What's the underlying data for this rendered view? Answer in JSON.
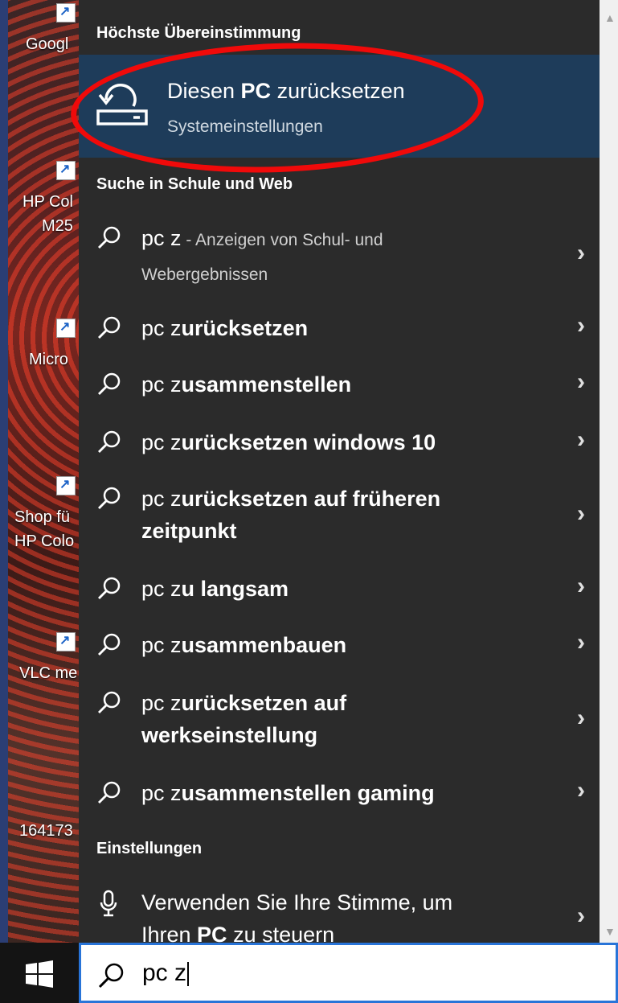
{
  "desktop": {
    "icons": [
      {
        "label": "Googl"
      },
      {
        "label": "HP Col"
      },
      {
        "label": "M25"
      },
      {
        "label": "Micro"
      },
      {
        "label": "Shop fü"
      },
      {
        "label": "HP Colo"
      },
      {
        "label": "VLC me"
      },
      {
        "label": "164173"
      }
    ]
  },
  "search_panel": {
    "best_match_heading": "Höchste Übereinstimmung",
    "best_match": {
      "title_pre": "Diesen ",
      "title_bold": "PC",
      "title_post": " zurücksetzen",
      "subtitle": "Systemeinstellungen",
      "icon": "reset-pc-icon"
    },
    "web_heading": "Suche in Schule und Web",
    "suggestions": [
      {
        "prefix": "pc z",
        "bold": "",
        "hint": " - Anzeigen von Schul- und",
        "line2": "Webergebnissen",
        "line2_bold": false
      },
      {
        "prefix": "pc z",
        "bold": "urücksetzen",
        "hint": "",
        "line2": "",
        "line2_bold": false
      },
      {
        "prefix": "pc z",
        "bold": "usammenstellen",
        "hint": "",
        "line2": "",
        "line2_bold": false
      },
      {
        "prefix": "pc z",
        "bold": "urücksetzen windows 10",
        "hint": "",
        "line2": "",
        "line2_bold": false
      },
      {
        "prefix": "pc z",
        "bold": "urücksetzen auf früheren",
        "hint": "",
        "line2": "zeitpunkt",
        "line2_bold": true
      },
      {
        "prefix": "pc z",
        "bold": "u langsam",
        "hint": "",
        "line2": "",
        "line2_bold": false
      },
      {
        "prefix": "pc z",
        "bold": "usammenbauen",
        "hint": "",
        "line2": "",
        "line2_bold": false
      },
      {
        "prefix": "pc z",
        "bold": "urücksetzen auf",
        "hint": "",
        "line2": "werkseinstellung",
        "line2_bold": true
      },
      {
        "prefix": "pc z",
        "bold": "usammenstellen gaming",
        "hint": "",
        "line2": "",
        "line2_bold": false
      }
    ],
    "settings_heading": "Einstellungen",
    "settings_item": {
      "line1": "Verwenden Sie Ihre Stimme, um",
      "line2_pre": "Ihren ",
      "line2_bold": "PC",
      "line2_post": " zu steuern",
      "icon": "microphone-icon"
    }
  },
  "taskbar": {
    "search_value": "pc z",
    "start_icon": "windows-logo-icon"
  },
  "colors": {
    "panel_bg": "#2b2b2b",
    "best_match_bg": "#1e3c5a",
    "highlight_oval": "#f00a0a",
    "search_border": "#2874d8"
  }
}
